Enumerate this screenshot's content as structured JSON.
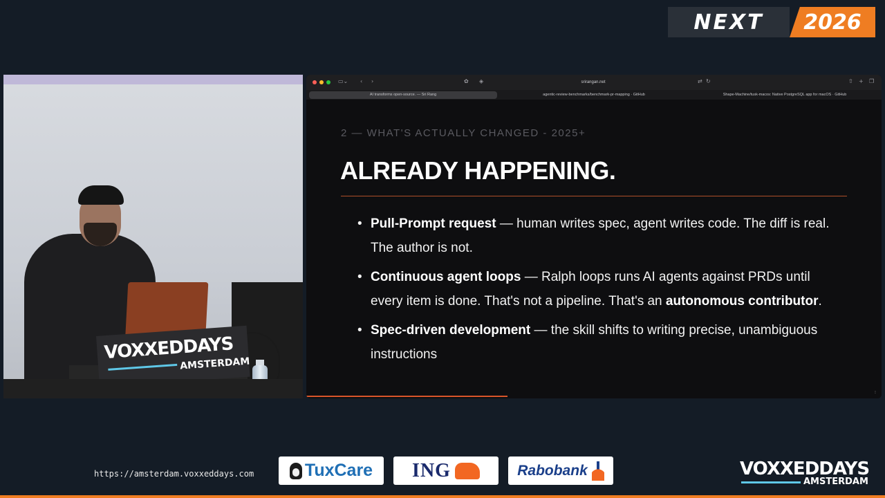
{
  "brand": {
    "event_left": "NEXT",
    "event_right": "2026",
    "accent": "#ef7d22"
  },
  "camera": {
    "podium_sign": {
      "name": "VOXXEDDAYS",
      "city": "AMSTERDAM"
    }
  },
  "browser": {
    "url": "srirangan.net",
    "tabs": [
      {
        "label": "AI transforms open-source. — Sri Rang",
        "active": true
      },
      {
        "label": "agentic-review-benchmarks/benchmark-pr-mapping · GitHub",
        "active": false
      },
      {
        "label": "Shape-Machine/tusk-macos: Native PostgreSQL app for macOS · GitHub",
        "active": false
      }
    ],
    "toolbar_icons": [
      "sidebar-icon",
      "back-icon",
      "forward-icon",
      "paw-icon",
      "shield-icon",
      "share-icon",
      "new-tab-icon",
      "tabs-icon"
    ]
  },
  "slide": {
    "kicker": "2 — WHAT'S ACTUALLY CHANGED - 2025+",
    "title": "ALREADY HAPPENING.",
    "progress": 0.35,
    "bullets": [
      {
        "bold": "Pull-Prompt request",
        "text": " — human writes spec, agent writes code. The diff is real. The author is not."
      },
      {
        "bold": "Continuous agent loops",
        "text": " — Ralph loops runs AI agents against PRDs until every item is done. That's not a pipeline. That's an ",
        "bold2": "autonomous contributor",
        "text2": "."
      },
      {
        "bold": "Spec-driven development",
        "text": " — the skill shifts to writing precise, unambiguous instructions"
      }
    ]
  },
  "footer": {
    "url": "https://amsterdam.voxxeddays.com",
    "sponsors": [
      "TuxCare",
      "ING",
      "Rabobank"
    ],
    "logo": {
      "name": "VOXXEDDAYS",
      "city": "AMSTERDAM"
    }
  }
}
